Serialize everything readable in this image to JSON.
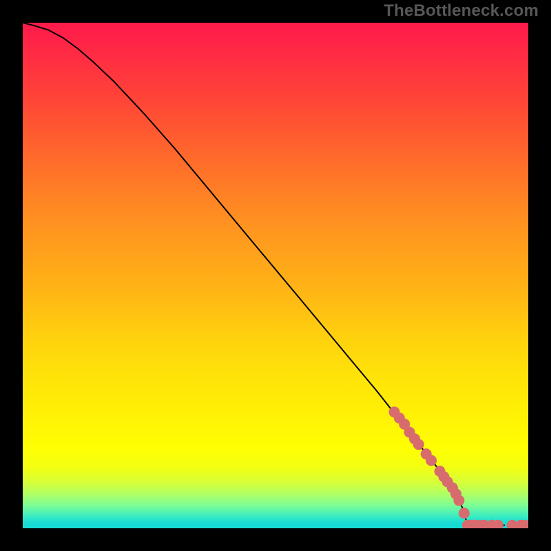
{
  "watermark_text": "TheBottleneck.com",
  "colors": {
    "frame": "#000000",
    "curve": "#000000",
    "marker": "#d86b6d",
    "gradient_top": "#ff1a4b",
    "gradient_bottom": "#18dcd4"
  },
  "chart_data": {
    "type": "line",
    "title": "",
    "xlabel": "",
    "ylabel": "",
    "xlim": [
      0,
      100
    ],
    "ylim": [
      0,
      100
    ],
    "series": [
      {
        "name": "curve",
        "x": [
          0,
          2,
          5,
          8,
          11,
          14,
          18,
          24,
          30,
          38,
          46,
          54,
          62,
          70,
          76,
          82,
          85,
          87,
          88
        ],
        "y": [
          100,
          99.5,
          98.6,
          97,
          94.8,
          92.2,
          88.4,
          82,
          75.2,
          65.6,
          56,
          46.4,
          36.8,
          27.2,
          19.6,
          12,
          8,
          4,
          0.6
        ]
      },
      {
        "name": "flat-tail-dashed",
        "x": [
          88,
          100
        ],
        "y": [
          0.6,
          0.6
        ]
      }
    ],
    "markers": {
      "name": "highlighted-points",
      "points": [
        {
          "x": 73.5,
          "y": 23.0
        },
        {
          "x": 74.5,
          "y": 21.8
        },
        {
          "x": 75.5,
          "y": 20.6
        },
        {
          "x": 76.5,
          "y": 19.0
        },
        {
          "x": 77.5,
          "y": 17.7
        },
        {
          "x": 78.3,
          "y": 16.6
        },
        {
          "x": 79.8,
          "y": 14.7
        },
        {
          "x": 80.8,
          "y": 13.4
        },
        {
          "x": 82.5,
          "y": 11.3
        },
        {
          "x": 83.3,
          "y": 10.2
        },
        {
          "x": 84.0,
          "y": 9.2
        },
        {
          "x": 85.0,
          "y": 8.0
        },
        {
          "x": 85.7,
          "y": 6.8
        },
        {
          "x": 86.3,
          "y": 5.5
        },
        {
          "x": 87.3,
          "y": 3.0
        },
        {
          "x": 88.0,
          "y": 0.6
        },
        {
          "x": 88.8,
          "y": 0.6
        },
        {
          "x": 89.5,
          "y": 0.6
        },
        {
          "x": 90.5,
          "y": 0.6
        },
        {
          "x": 91.3,
          "y": 0.6
        },
        {
          "x": 92.8,
          "y": 0.6
        },
        {
          "x": 94.0,
          "y": 0.6
        },
        {
          "x": 96.8,
          "y": 0.6
        },
        {
          "x": 98.5,
          "y": 0.6
        },
        {
          "x": 99.3,
          "y": 0.6
        }
      ]
    }
  }
}
